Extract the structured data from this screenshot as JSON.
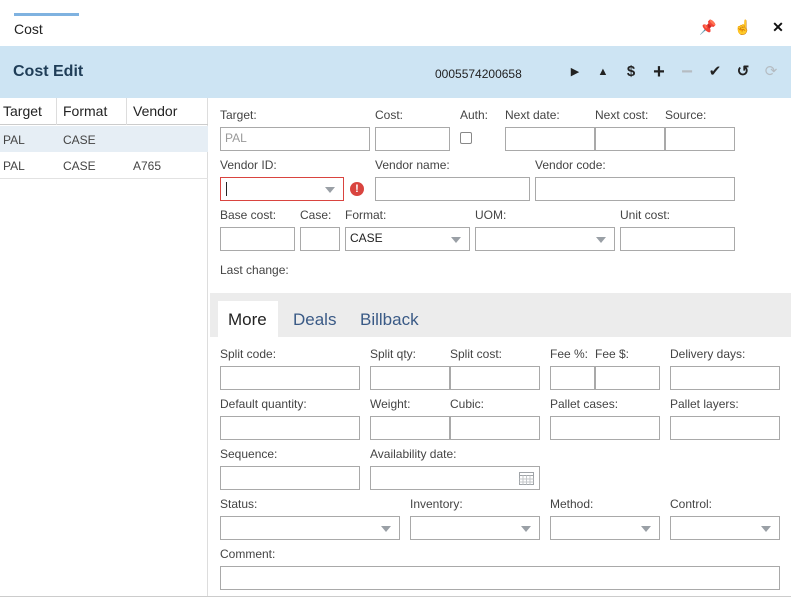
{
  "window": {
    "title": "Cost",
    "pin_icon": "pin-icon",
    "hand_icon": "hand-pointer-icon",
    "close_icon": "close-icon"
  },
  "header": {
    "title": "Cost Edit",
    "record_id": "0005574200658",
    "toolbar": [
      {
        "name": "next-icon",
        "glyph": "▶",
        "enabled": true
      },
      {
        "name": "up-icon",
        "glyph": "▲",
        "enabled": true
      },
      {
        "name": "dollar-icon",
        "glyph": "$",
        "enabled": true
      },
      {
        "name": "add-icon",
        "glyph": "+",
        "enabled": true
      },
      {
        "name": "remove-icon",
        "glyph": "−",
        "enabled": false
      },
      {
        "name": "check-icon",
        "glyph": "✔",
        "enabled": true
      },
      {
        "name": "undo-icon",
        "glyph": "↺",
        "enabled": true
      },
      {
        "name": "refresh-icon",
        "glyph": "⟳",
        "enabled": false
      }
    ]
  },
  "list": {
    "columns": [
      "Target",
      "Format",
      "Vendor"
    ],
    "rows": [
      {
        "target": "PAL",
        "format": "CASE",
        "vendor": ""
      },
      {
        "target": "PAL",
        "format": "CASE",
        "vendor": "A765"
      }
    ]
  },
  "form": {
    "target_label": "Target:",
    "target_value": "PAL",
    "cost_label": "Cost:",
    "auth_label": "Auth:",
    "next_date_label": "Next date:",
    "next_cost_label": "Next cost:",
    "source_label": "Source:",
    "vendor_id_label": "Vendor ID:",
    "vendor_name_label": "Vendor name:",
    "vendor_code_label": "Vendor code:",
    "base_cost_label": "Base cost:",
    "case_label": "Case:",
    "format_label": "Format:",
    "format_value": "CASE",
    "uom_label": "UOM:",
    "unit_cost_label": "Unit cost:",
    "last_change_label": "Last change:"
  },
  "tabs": [
    "More",
    "Deals",
    "Billback"
  ],
  "more": {
    "split_code_label": "Split code:",
    "split_qty_label": "Split qty:",
    "split_cost_label": "Split cost:",
    "fee_pct_label": "Fee %:",
    "fee_amt_label": "Fee $:",
    "delivery_days_label": "Delivery days:",
    "default_qty_label": "Default quantity:",
    "weight_label": "Weight:",
    "cubic_label": "Cubic:",
    "pallet_cases_label": "Pallet cases:",
    "pallet_layers_label": "Pallet layers:",
    "sequence_label": "Sequence:",
    "availability_date_label": "Availability date:",
    "status_label": "Status:",
    "inventory_label": "Inventory:",
    "method_label": "Method:",
    "control_label": "Control:",
    "comment_label": "Comment:"
  },
  "colors": {
    "header_bg": "#cde4f3",
    "accent_underline": "#7fb2e0",
    "error": "#d9443f",
    "tab_text": "#3a5a86"
  }
}
